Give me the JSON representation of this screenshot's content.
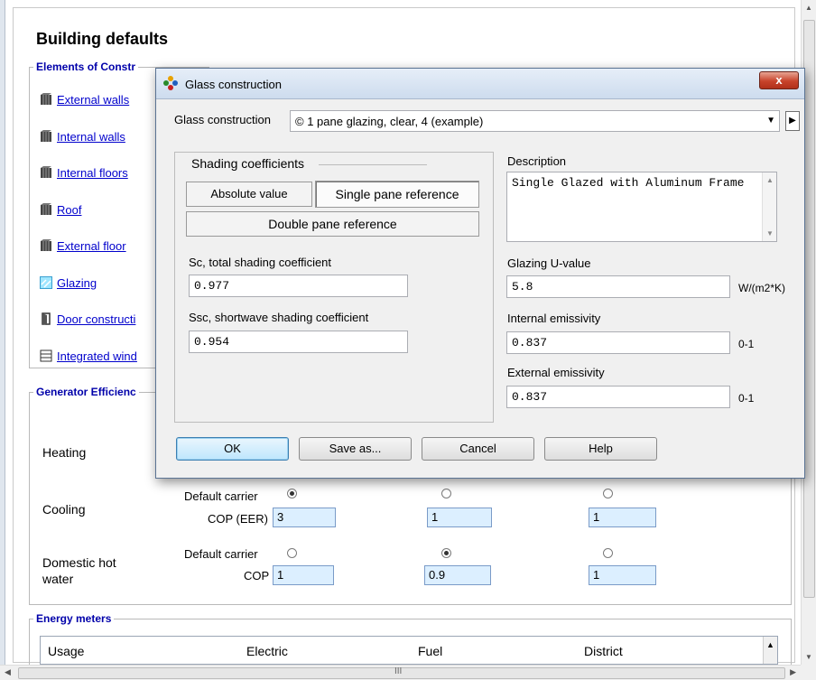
{
  "page": {
    "title": "Building defaults",
    "elements_group": "Elements of Constr",
    "elements": [
      {
        "label": "External walls",
        "icon": "wall-icon"
      },
      {
        "label": "Internal walls",
        "icon": "wall-icon"
      },
      {
        "label": "Internal floors",
        "icon": "wall-icon"
      },
      {
        "label": "Roof",
        "icon": "wall-icon"
      },
      {
        "label": "External floor",
        "icon": "wall-icon"
      },
      {
        "label": "Glazing",
        "icon": "glazing-icon"
      },
      {
        "label": "Door constructi",
        "icon": "door-icon"
      },
      {
        "label": "Integrated wind",
        "icon": "window-icon"
      }
    ],
    "generator_group": "Generator Efficienc",
    "heating_label": "Heating",
    "cooling": {
      "label": "Cooling",
      "carrier_label": "Default carrier",
      "cop_label": "COP (EER)",
      "values": [
        "3",
        "1",
        "1"
      ],
      "selected": 0
    },
    "dhw": {
      "label": "Domestic hot water",
      "carrier_label": "Default carrier",
      "cop_label": "COP",
      "values": [
        "1",
        "0.9",
        "1"
      ],
      "selected": 1
    },
    "energy_group": "Energy meters",
    "energy_columns": [
      "Usage",
      "Electric",
      "Fuel",
      "District"
    ],
    "scroll_marker": "III"
  },
  "dialog": {
    "title": "Glass construction",
    "close_label": "x",
    "construction_label": "Glass construction",
    "construction_value": "© 1 pane glazing, clear, 4 (example)",
    "shading_group": "Shading coefficients",
    "btn_absolute": "Absolute value",
    "btn_single": "Single pane reference",
    "btn_double": "Double pane reference",
    "sc_label": "Sc, total shading coefficient",
    "sc_value": "0.977",
    "ssc_label": "Ssc, shortwave shading coefficient",
    "ssc_value": "0.954",
    "description_label": "Description",
    "description_value": "Single Glazed with Aluminum Frame",
    "uvalue_label": "Glazing U-value",
    "uvalue_value": "5.8",
    "uvalue_unit": "W/(m2*K)",
    "int_em_label": "Internal emissivity",
    "int_em_value": "0.837",
    "int_em_unit": "0-1",
    "ext_em_label": "External emissivity",
    "ext_em_value": "0.837",
    "ext_em_unit": "0-1",
    "ok": "OK",
    "save_as": "Save as...",
    "cancel": "Cancel",
    "help": "Help"
  }
}
